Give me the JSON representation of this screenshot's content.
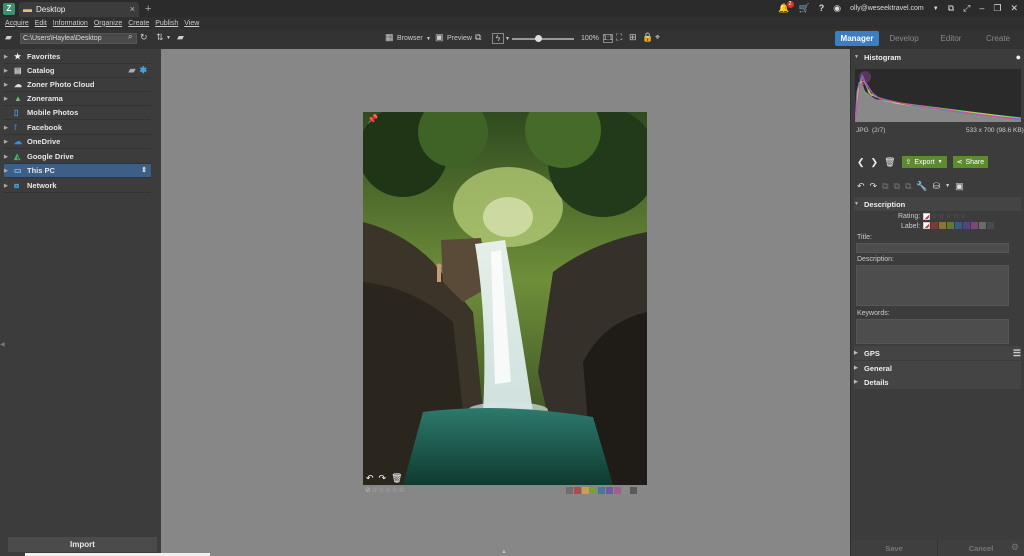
{
  "titlebar": {
    "tab_title": "Desktop",
    "new_tab": "+",
    "notification_count": "2",
    "help": "?",
    "email": "olly@weseektravel.com"
  },
  "menu": [
    "Acquire",
    "Edit",
    "Information",
    "Organize",
    "Create",
    "Publish",
    "View"
  ],
  "toolbar": {
    "path": "C:\\Users\\Haylea\\Desktop",
    "browser_label": "Browser",
    "preview_label": "Preview",
    "zoom": "100%"
  },
  "modes": {
    "manager": "Manager",
    "develop": "Develop",
    "editor": "Editor",
    "create": "Create"
  },
  "nav": {
    "items": [
      {
        "label": "Favorites",
        "icon": "star-icon"
      },
      {
        "label": "Catalog",
        "icon": "catalog-icon"
      },
      {
        "label": "Zoner Photo Cloud",
        "icon": "cloud-icon"
      },
      {
        "label": "Zonerama",
        "icon": "zonerama-icon"
      },
      {
        "label": "Mobile Photos",
        "icon": "mobile-icon"
      },
      {
        "label": "Facebook",
        "icon": "facebook-icon"
      },
      {
        "label": "OneDrive",
        "icon": "onedrive-icon"
      },
      {
        "label": "Google Drive",
        "icon": "google-drive-icon"
      },
      {
        "label": "This PC",
        "icon": "pc-icon"
      },
      {
        "label": "Network",
        "icon": "network-icon"
      }
    ],
    "import_label": "Import"
  },
  "photo": {
    "label_colors": [
      "#b34a4a",
      "#c9a046",
      "#7b9c43",
      "#4a74a6",
      "#6b5aa6",
      "#a45c98",
      "#8a8a8a",
      "#5a5a5a"
    ]
  },
  "right": {
    "histogram_title": "Histogram",
    "format": "JPG",
    "index": "(2/7)",
    "dims": "533 x 700 (98.6 KB)",
    "export_label": "Export",
    "share_label": "Share",
    "description_section": "Description",
    "rating_label": "Rating:",
    "label_label": "Label:",
    "title_field_label": "Title:",
    "description_field_label": "Description:",
    "keywords_field_label": "Keywords:",
    "gps_label": "GPS",
    "general_label": "General",
    "details_label": "Details",
    "save_label": "Save",
    "cancel_label": "Cancel",
    "label_colors": [
      "#7a3a3a",
      "#8a7336",
      "#5f7a33",
      "#3b5a80",
      "#51457f",
      "#7d4774",
      "#6a6a6a",
      "#4a4a4a"
    ]
  }
}
